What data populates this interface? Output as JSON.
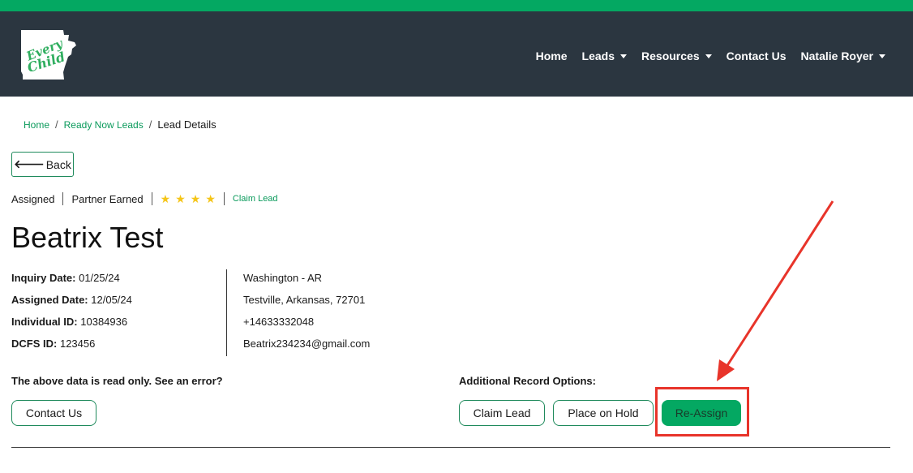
{
  "brand": {
    "logo_alt": "Every Child",
    "accent": "#04a862",
    "header_bg": "#2b3640",
    "annotation": "#e8342a"
  },
  "nav": {
    "items": [
      {
        "label": "Home",
        "dropdown": false
      },
      {
        "label": "Leads",
        "dropdown": true
      },
      {
        "label": "Resources",
        "dropdown": true
      },
      {
        "label": "Contact Us",
        "dropdown": false
      },
      {
        "label": "Natalie Royer",
        "dropdown": true
      }
    ]
  },
  "breadcrumb": {
    "home": "Home",
    "ready_now": "Ready Now Leads",
    "current": "Lead Details",
    "sep": "/"
  },
  "back_button": {
    "label": "Back",
    "icon": "arrow-left-icon"
  },
  "status": {
    "assigned": "Assigned",
    "partner": "Partner Earned",
    "stars": 4,
    "star_glyph": "★",
    "claim_link": "Claim Lead"
  },
  "lead": {
    "name": "Beatrix Test",
    "inquiry_label": "Inquiry Date:",
    "inquiry_value": "01/25/24",
    "assigned_label": "Assigned Date:",
    "assigned_value": "12/05/24",
    "individual_label": "Individual ID:",
    "individual_value": "10384936",
    "dcfs_label": "DCFS ID:",
    "dcfs_value": "123456",
    "county": "Washington - AR",
    "address": "Testville, Arkansas, 72701",
    "phone": "+14633332048",
    "email": "Beatrix234234@gmail.com"
  },
  "notes": {
    "readonly": "The above data is read only. See an error?",
    "options_title": "Additional Record Options:"
  },
  "buttons": {
    "contact": "Contact Us",
    "claim": "Claim Lead",
    "hold": "Place on Hold",
    "reassign": "Re-Assign"
  }
}
